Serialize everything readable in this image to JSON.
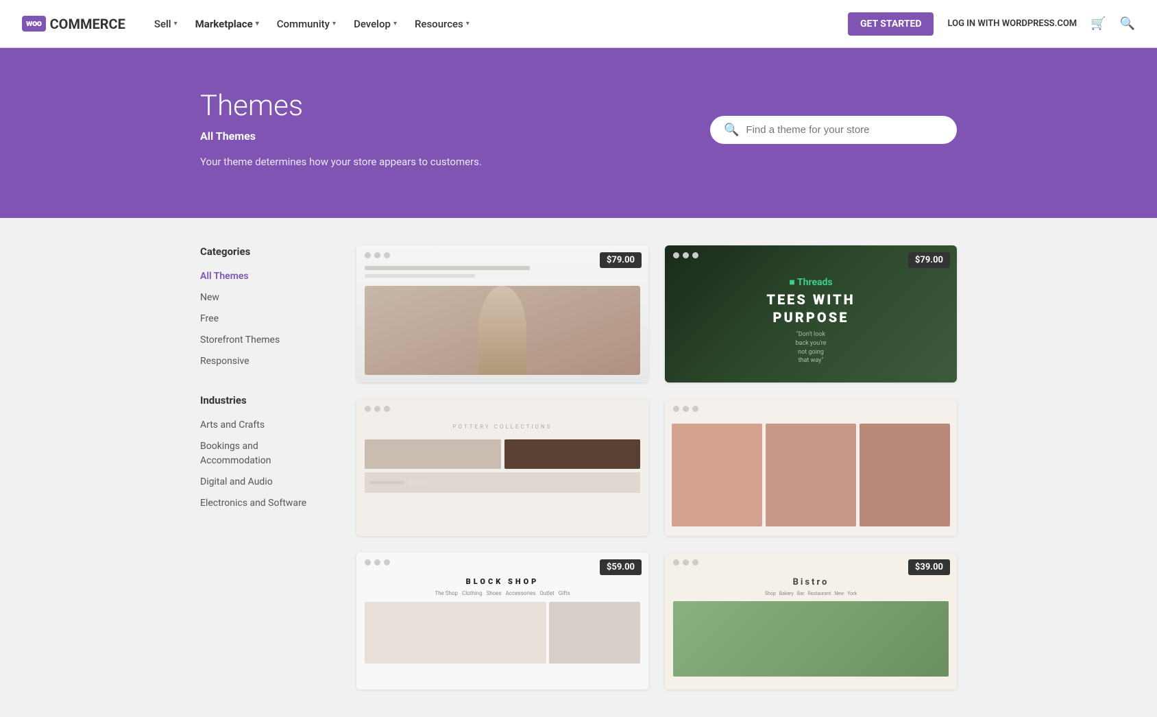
{
  "navbar": {
    "logo_box": "woo",
    "logo_text": "COMMERCE",
    "sell_label": "Sell",
    "marketplace_label": "Marketplace",
    "community_label": "Community",
    "develop_label": "Develop",
    "resources_label": "Resources",
    "get_started_label": "GET STARTED",
    "login_label": "LOG IN WITH WORDPRESS.COM"
  },
  "hero": {
    "title": "Themes",
    "subtitle": "All Themes",
    "description": "Your theme determines how your store appears to customers.",
    "search_placeholder": "Find a theme for your store"
  },
  "sidebar": {
    "categories_title": "Categories",
    "categories": [
      {
        "label": "All Themes",
        "active": true
      },
      {
        "label": "New"
      },
      {
        "label": "Free"
      },
      {
        "label": "Storefront Themes"
      },
      {
        "label": "Responsive"
      }
    ],
    "industries_title": "Industries",
    "industries": [
      {
        "label": "Arts and Crafts"
      },
      {
        "label": "Bookings and Accommodation"
      },
      {
        "label": "Digital and Audio"
      },
      {
        "label": "Electronics and Software"
      }
    ]
  },
  "themes": [
    {
      "type": "artisan",
      "price": "$79.00"
    },
    {
      "type": "threads",
      "price": "$79.00"
    },
    {
      "type": "pottery",
      "price": ""
    },
    {
      "type": "fashion",
      "price": ""
    },
    {
      "type": "blockshop",
      "price": "$59.00"
    },
    {
      "type": "bistro",
      "price": "$39.00"
    }
  ]
}
